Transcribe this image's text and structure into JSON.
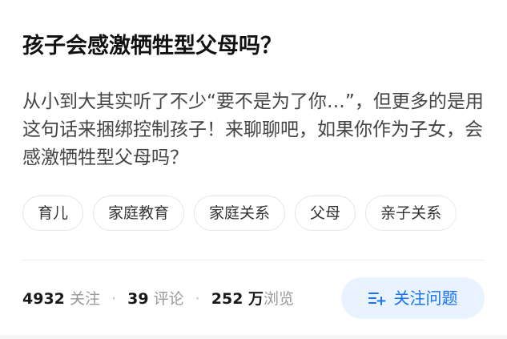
{
  "question": {
    "title": "孩子会感激牺牲型父母吗？",
    "description": "从小到大其实听了不少“要不是为了你…”，但更多的是用这句话来捆绑控制孩子！来聊聊吧，如果你作为子女，会感激牺牲型父母吗？"
  },
  "tags": [
    "育儿",
    "家庭教育",
    "家庭关系",
    "父母",
    "亲子关系"
  ],
  "stats": {
    "followers_count": "4932",
    "followers_label": "关注",
    "comments_count": "39",
    "comments_label": "评论",
    "views_count": "252 万",
    "views_label": "浏览",
    "separator": "·"
  },
  "follow_button": {
    "label": "关注问题",
    "icon": "follow-list-plus-icon"
  },
  "colors": {
    "accent": "#1772f6",
    "button_bg": "#e9f2ff"
  }
}
